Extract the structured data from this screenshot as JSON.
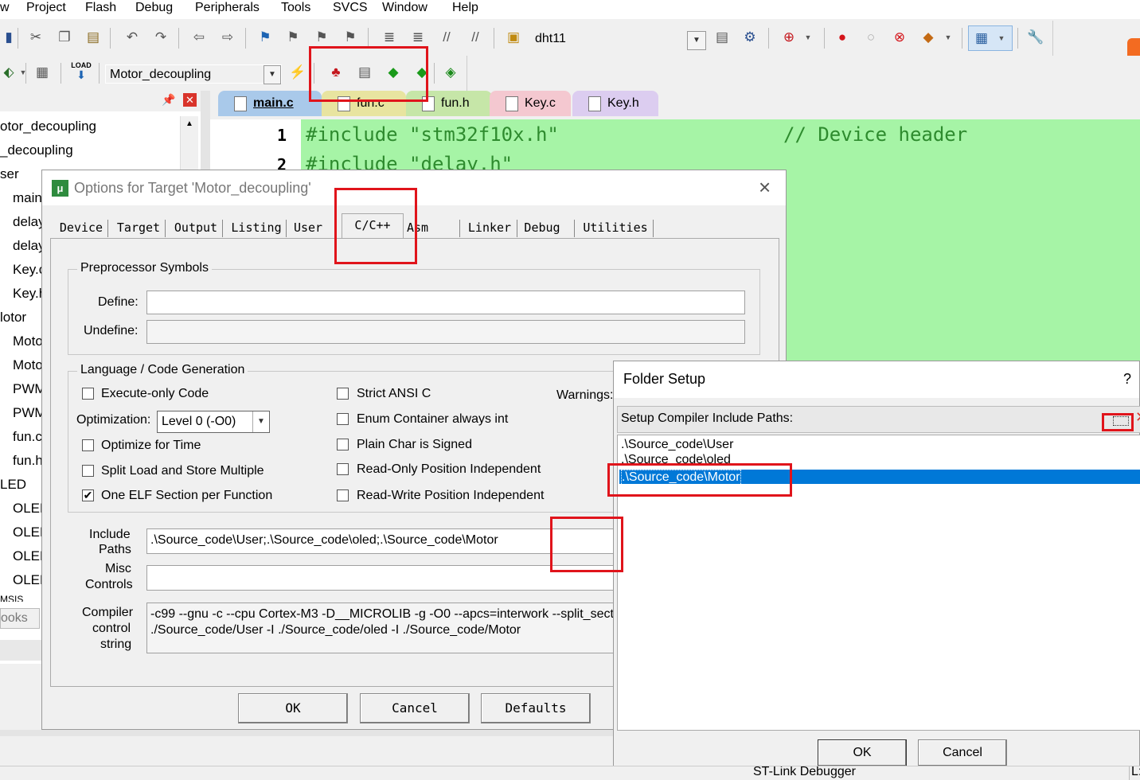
{
  "menu": [
    "w",
    "Project",
    "Flash",
    "Debug",
    "Peripherals",
    "Tools",
    "SVCS",
    "Window",
    "Help"
  ],
  "toolbar1": {
    "target_name": "dht11"
  },
  "toolbar2": {
    "target_combo": "Motor_decoupling",
    "load_label": "LOAD"
  },
  "project_panel": {
    "items": [
      "otor_decoupling",
      "_decoupling",
      "ser",
      "main",
      "delay",
      "delay",
      "Key.c",
      "Key.h",
      "lotor",
      "Moto",
      "Moto",
      "PWM",
      "PWM",
      "fun.c",
      "fun.h",
      "LED",
      "OLED",
      "OLED",
      "OLED",
      "OLED",
      "MSIS"
    ],
    "bottom_tab": "ooks"
  },
  "editor": {
    "tabs": [
      "main.c",
      "fun.c",
      "fun.h",
      "Key.c",
      "Key.h"
    ],
    "lines": [
      {
        "num": "1",
        "code": "#include \"stm32f10x.h\"",
        "comment": "// Device header"
      },
      {
        "num": "2",
        "code": "#include \"delay.h\"",
        "comment": ""
      }
    ]
  },
  "options_dialog": {
    "title": "Options for Target 'Motor_decoupling'",
    "tabs": [
      "Device",
      "Target",
      "Output",
      "Listing",
      "User",
      "C/C++",
      "Asm",
      "Linker",
      "Debug",
      "Utilities"
    ],
    "active_tab": "C/C++",
    "preprocessor": {
      "title": "Preprocessor Symbols",
      "define_label": "Define:",
      "define_value": "",
      "undefine_label": "Undefine:",
      "undefine_value": ""
    },
    "language": {
      "title": "Language / Code Generation",
      "execute_only": "Execute-only Code",
      "optimization_label": "Optimization:",
      "optimization_value": "Level 0 (-O0)",
      "optimize_time": "Optimize for Time",
      "split_load": "Split Load and Store Multiple",
      "one_elf": "One ELF Section per Function",
      "strict_ansi": "Strict ANSI C",
      "enum_container": "Enum Container always int",
      "plain_char": "Plain Char is Signed",
      "ro_pi": "Read-Only Position Independent",
      "rw_pi": "Read-Write Position Independent",
      "warnings_label": "Warnings:"
    },
    "include_label_1": "Include",
    "include_label_2": "Paths",
    "include_value": ".\\Source_code\\User;.\\Source_code\\oled;.\\Source_code\\Motor",
    "misc_label_1": "Misc",
    "misc_label_2": "Controls",
    "misc_value": "",
    "compiler_label_1": "Compiler",
    "compiler_label_2": "control",
    "compiler_label_3": "string",
    "compiler_line1": "-c99 --gnu -c --cpu Cortex-M3 -D__MICROLIB -g -O0 --apcs=interwork --split_sectio",
    "compiler_line2": "./Source_code/User -I ./Source_code/oled -I ./Source_code/Motor",
    "ok": "OK",
    "cancel": "Cancel",
    "defaults": "Defaults"
  },
  "folder_dialog": {
    "title": "Folder Setup",
    "help": "?",
    "header": "Setup Compiler Include Paths:",
    "paths": [
      ".\\Source_code\\User",
      ".\\Source_code\\oled",
      ".\\Source_code\\Motor"
    ],
    "selected_index": 2,
    "ok": "OK",
    "cancel": "Cancel"
  },
  "status": {
    "debugger": "ST-Link Debugger",
    "right": "L:"
  },
  "colors": {
    "highlight": "#e0141b",
    "selection": "#0078d7",
    "editor_bg": "#a6f4a6",
    "code_green": "#2e8b2e"
  }
}
